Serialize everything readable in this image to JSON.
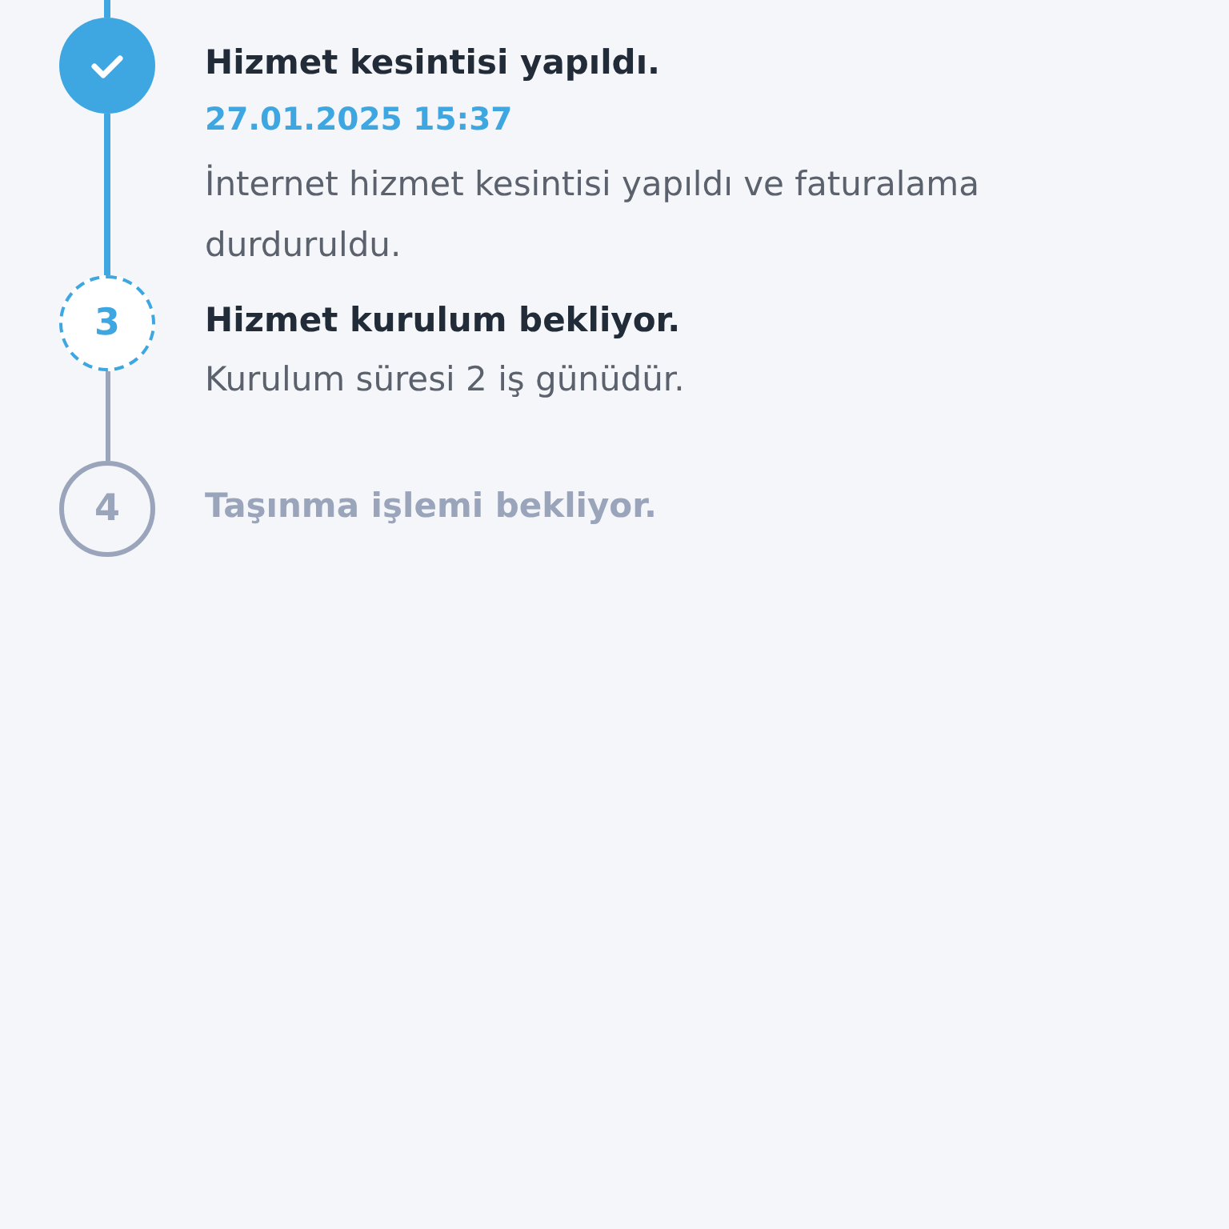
{
  "timeline": {
    "steps": [
      {
        "kind": "done",
        "title": "Hizmet kesintisi yapıldı.",
        "date": "27.01.2025 15:37",
        "description": "İnternet hizmet kesintisi yapıldı ve faturalama durduruldu."
      },
      {
        "kind": "current",
        "number": "3",
        "title": "Hizmet kurulum bekliyor.",
        "description": "Kurulum süresi 2 iş günüdür."
      },
      {
        "kind": "pending",
        "number": "4",
        "title": "Taşınma işlemi bekliyor."
      }
    ]
  }
}
